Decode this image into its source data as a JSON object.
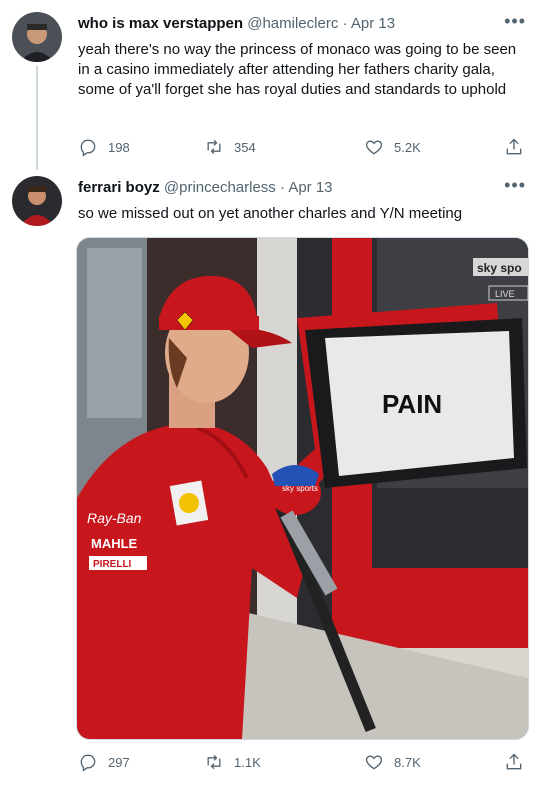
{
  "tweets": [
    {
      "name": "who is max verstappen",
      "handle": "@hamileclerc",
      "dot": "·",
      "date": "Apr 13",
      "text": "yeah there's no way the princess of monaco was going to be seen in a casino immediately after attending her fathers charity gala, some of ya'll forget she has royal duties and standards to uphold",
      "stats": {
        "replies": "198",
        "retweets": "354",
        "likes": "5.2K"
      }
    },
    {
      "name": "ferrari boyz",
      "handle": "@princecharless",
      "dot": "·",
      "date": "Apr 13",
      "text": "so we missed out on yet another charles and Y/N meeting",
      "stats": {
        "replies": "297",
        "retweets": "1.1K",
        "likes": "8.7K"
      }
    }
  ],
  "media": {
    "sign_text": "PAIN",
    "sponsor_patches": [
      "Ray-Ban",
      "MAHLE",
      "PIRELLI"
    ],
    "mic_label": "sky sports",
    "broadcast_logo": "sky spo",
    "broadcast_live": "LIVE"
  },
  "colors": {
    "text": "#0f1419",
    "muted": "#536471",
    "border": "#cfd9de",
    "ferrari_red": "#c8161d"
  },
  "icons": [
    "reply-icon",
    "retweet-icon",
    "like-icon",
    "share-icon",
    "more-icon"
  ]
}
